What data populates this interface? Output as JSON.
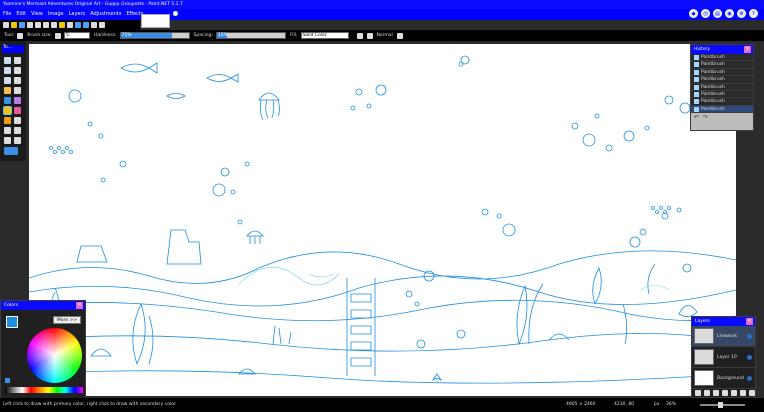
{
  "titlebar": {
    "title": "Yasmine's Mermaid Adventures Original Art - Guppy Groupsets - Paint.NET 5.1.7"
  },
  "menu": {
    "items": [
      "File",
      "Edit",
      "View",
      "Image",
      "Layers",
      "Adjustments",
      "Effects"
    ]
  },
  "tool_options": {
    "tools_label": "Tool:",
    "brush_size_label": "Brush size:",
    "brush_size_value": "5",
    "hardness_label": "Hardness:",
    "hardness_value": "75%",
    "hardness_fraction": 0.75,
    "spacing_label": "Spacing:",
    "spacing_value": "15%",
    "spacing_fraction": 0.15,
    "fill_label": "Fill:",
    "fill_value": "Solid Color",
    "blend_mode": "Normal"
  },
  "tools_panel": {
    "header": "To..."
  },
  "history_panel": {
    "title": "History",
    "items": [
      "Paintbrush",
      "Paintbrush",
      "Paintbrush",
      "Paintbrush",
      "Paintbrush",
      "Paintbrush",
      "Paintbrush",
      "Paintbrush"
    ],
    "selected_index": 7
  },
  "colors_panel": {
    "title": "Colors",
    "more_label": "More >>"
  },
  "layers_panel": {
    "title": "Layers",
    "layers": [
      {
        "name": "Linework",
        "selected": true
      },
      {
        "name": "Layer 10",
        "selected": false
      },
      {
        "name": "Background",
        "selected": false
      }
    ]
  },
  "status": {
    "hint": "Left click to draw with primary color, right click to draw with secondary color.",
    "image_size": "4905 × 2460",
    "cursor_pos": "4230, 80",
    "units": "px",
    "zoom": "36%"
  },
  "colors": {
    "accent": "#0a0aff",
    "linework": "#1f8fe0",
    "primary_color": "#1f8fe0",
    "secondary_color": "#ffffff"
  }
}
